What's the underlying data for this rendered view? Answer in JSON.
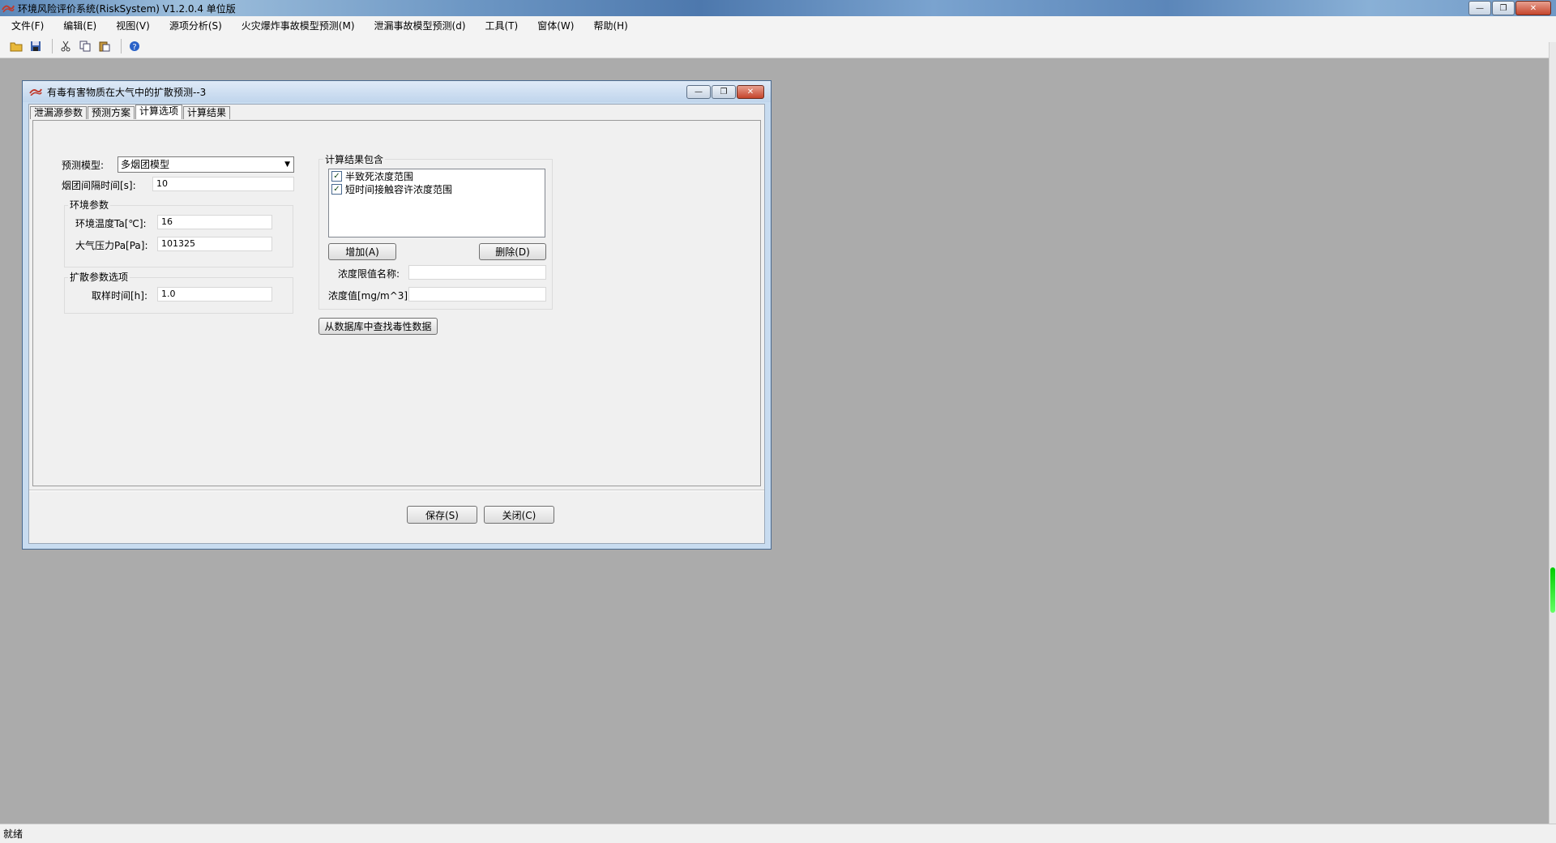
{
  "app": {
    "title": "环境风险评价系统(RiskSystem) V1.2.0.4 单位版",
    "status": "就绪"
  },
  "menu": [
    "文件(F)",
    "编辑(E)",
    "视图(V)",
    "源项分析(S)",
    "火灾爆炸事故模型预测(M)",
    "泄漏事故模型预测(d)",
    "工具(T)",
    "窗体(W)",
    "帮助(H)"
  ],
  "dialog": {
    "title": "有毒有害物质在大气中的扩散预测--3",
    "tabs": [
      "泄漏源参数",
      "预测方案",
      "计算选项",
      "计算结果"
    ],
    "active_tab": "计算选项",
    "left": {
      "model_label": "预测模型:",
      "model_value": "多烟团模型",
      "interval_label": "烟团间隔时间[s]:",
      "interval_value": "10",
      "env_group": "环境参数",
      "temp_label": "环境温度Ta[℃]:",
      "temp_value": "16",
      "pressure_label": "大气压力Pa[Pa]:",
      "pressure_value": "101325",
      "diff_group": "扩散参数选项",
      "sample_label": "取样时间[h]:",
      "sample_value": "1.0"
    },
    "right": {
      "group": "计算结果包含",
      "items": [
        {
          "label": "半致死浓度范围",
          "checked": true
        },
        {
          "label": "短时间接触容许浓度范围",
          "checked": true
        }
      ],
      "add_button": "增加(A)",
      "delete_button": "删除(D)",
      "limit_name_label": "浓度限值名称:",
      "limit_name_value": "",
      "conc_label": "浓度值[mg/m^3]:",
      "conc_value": "",
      "db_button": "从数据库中查找毒性数据"
    },
    "save_button": "保存(S)",
    "close_button": "关闭(C)"
  }
}
